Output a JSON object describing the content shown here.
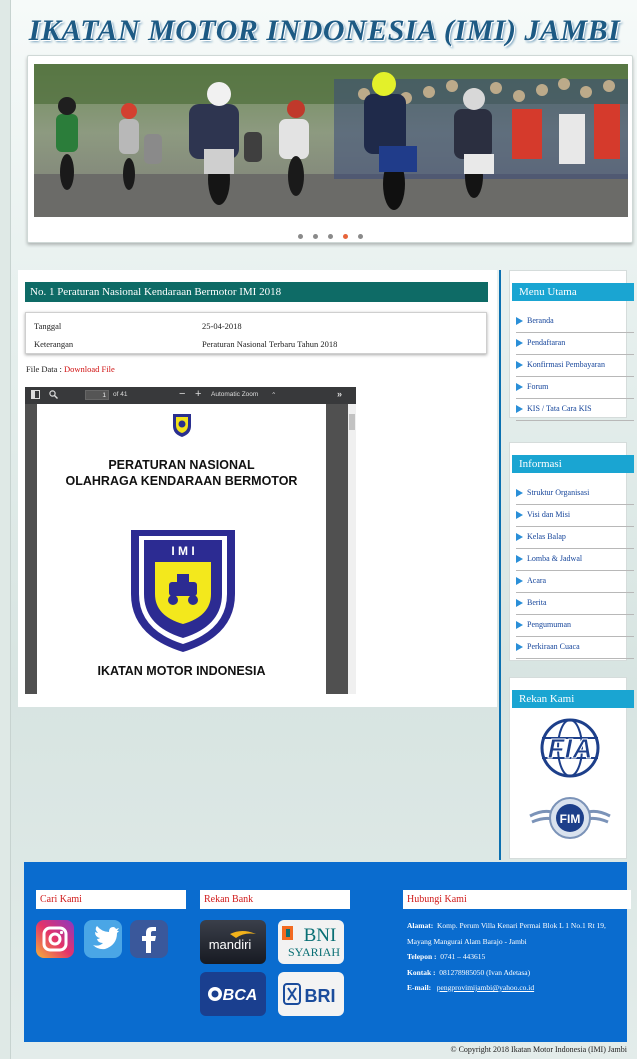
{
  "site": {
    "title": "IKATAN MOTOR INDONESIA (IMI) JAMBI"
  },
  "slider": {
    "dot_count": 5,
    "active_dot_index": 3
  },
  "post": {
    "title": "No. 1 Peraturan Nasional Kendaraan Bermotor IMI 2018",
    "rows": [
      {
        "key": "Tanggal",
        "value": "25-04-2018"
      },
      {
        "key": "Keterangan",
        "value": "Peraturan Nasional Terbaru Tahun 2018"
      }
    ],
    "file_label": "File Data :",
    "file_link": "Download File"
  },
  "pdf_viewer": {
    "page_number": "1",
    "page_of": "of 41",
    "zoom_label": "Automatic Zoom",
    "document": {
      "heading_line1": "PERATURAN NASIONAL",
      "heading_line2": "OLAHRAGA KENDARAAN BERMOTOR",
      "logo_letters": "I M I",
      "logo_ring_text": "IKATAN MOTOR INDONESIA",
      "footer_heading": "IKATAN MOTOR INDONESIA"
    }
  },
  "sidebar": {
    "menu_utama": {
      "title": "Menu Utama",
      "items": [
        "Beranda",
        "Pendaftaran",
        "Konfirmasi Pembayaran",
        "Forum",
        "KIS / Tata Cara KIS"
      ]
    },
    "informasi": {
      "title": "Informasi",
      "items": [
        "Struktur Organisasi",
        "Visi dan Misi",
        "Kelas Balap",
        "Lomba & Jadwal",
        "Acara",
        "Berita",
        "Pengumuman",
        "Perkiraan Cuaca"
      ]
    },
    "rekan_kami": {
      "title": "Rekan Kami",
      "logos": [
        "FIA",
        "FIM"
      ]
    }
  },
  "footer": {
    "cari_kami": "Cari Kami",
    "rekan_bank": "Rekan Bank",
    "hubungi_kami": "Hubungi Kami",
    "banks": {
      "mandiri": "mandiri",
      "bni": "BNI",
      "bni_sub": "SYARIAH",
      "bca": "BCA",
      "bri": "BRI"
    },
    "contact": {
      "alamat_label": "Alamat:",
      "alamat_value": "Komp. Perum Villa Kenari Permai Blok L 1 No.1 Rt 19, Mayang Mangurai Alam Barajo - Jambi",
      "telepon_label": "Telepon :",
      "telepon_value": "0741 – 443615",
      "kontak_label": "Kontak :",
      "kontak_value": "081278985050 (Ivan Adetasa)",
      "email_label": "E-mail:",
      "email_value": "pengprovimijambi@yahoo.co.id"
    }
  },
  "copyright": "© Copyright 2018 Ikatan Motor Indonesia (IMI) Jambi",
  "colors": {
    "post_title_bg": "#0e6b66",
    "side_head_bg": "#1aa5d2",
    "footer_bg": "#0a6ccf",
    "link_red": "#d01010"
  }
}
